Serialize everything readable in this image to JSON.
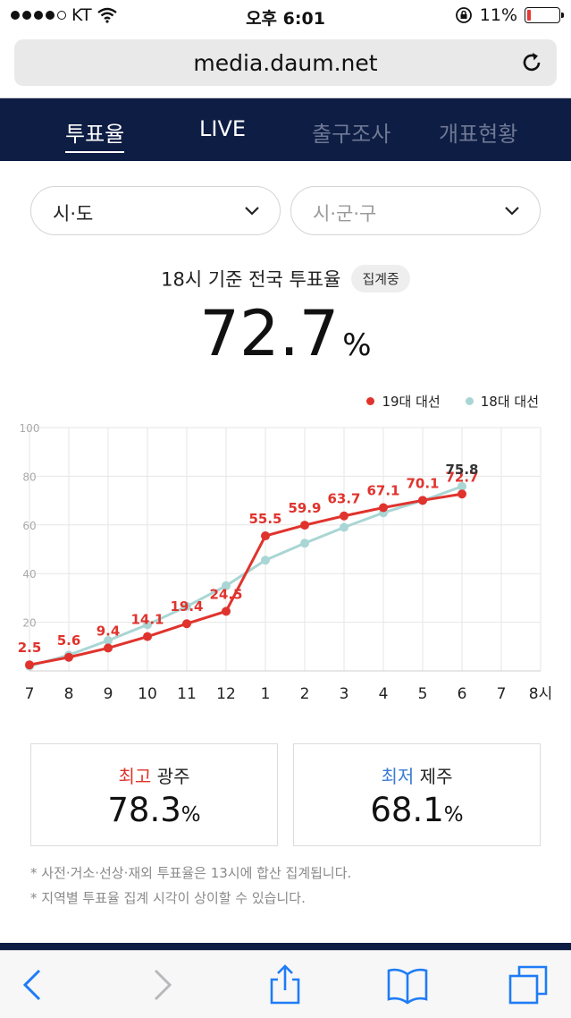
{
  "status_bar": {
    "carrier": "KT",
    "time": "오후 6:01",
    "battery": "11%",
    "battery_level": 0.11
  },
  "browser": {
    "url": "media.daum.net"
  },
  "nav": {
    "tabs": [
      {
        "label": "투표율",
        "active": true
      },
      {
        "label": "LIVE",
        "active": false
      },
      {
        "label": "출구조사",
        "active": false
      },
      {
        "label": "개표현황",
        "active": false
      }
    ]
  },
  "filters": {
    "sido": "시·도",
    "sigungu": "시·군·구"
  },
  "headline": {
    "title": "18시 기준 전국 투표율",
    "badge": "집계중",
    "rate": "72.7",
    "unit": "%"
  },
  "legend": [
    {
      "label": "19대 대선",
      "color": "#e0332d"
    },
    {
      "label": "18대 대선",
      "color": "#a9d6d4"
    }
  ],
  "chart_data": {
    "type": "line",
    "categories": [
      "7",
      "8",
      "9",
      "10",
      "11",
      "12",
      "1",
      "2",
      "3",
      "4",
      "5",
      "6",
      "7",
      "8시"
    ],
    "ylim": [
      0,
      100
    ],
    "yticks": [
      20,
      40,
      60,
      80,
      100
    ],
    "series": [
      {
        "name": "19대 대선",
        "color": "#e0332d",
        "values": [
          2.5,
          5.6,
          9.4,
          14.1,
          19.4,
          24.5,
          55.5,
          59.9,
          63.7,
          67.1,
          70.1,
          72.7
        ]
      },
      {
        "name": "18대 대선",
        "color": "#a9d6d4",
        "values": [
          2.0,
          6.5,
          12.5,
          19.0,
          26.5,
          35.0,
          45.5,
          52.5,
          59.0,
          65.0,
          70.0,
          75.8
        ]
      }
    ],
    "data_labels": [
      "2.5",
      "5.6",
      "9.4",
      "14.1",
      "19.4",
      "24.5",
      "55.5",
      "59.9",
      "63.7",
      "67.1",
      "70.1",
      "72.7"
    ],
    "extra_label": "75.8",
    "grid": true
  },
  "stats": {
    "highest": {
      "prefix": "최고",
      "region": "광주",
      "value": "78.3",
      "unit": "%",
      "color": "#e0332d"
    },
    "lowest": {
      "prefix": "최저",
      "region": "제주",
      "value": "68.1",
      "unit": "%",
      "color": "#3a7bd5"
    }
  },
  "notes": [
    "* 사전·거소·선상·재외 투표율은 13시에 합산 집계됩니다.",
    "* 지역별 투표율 집계 시각이 상이할 수 있습니다."
  ]
}
